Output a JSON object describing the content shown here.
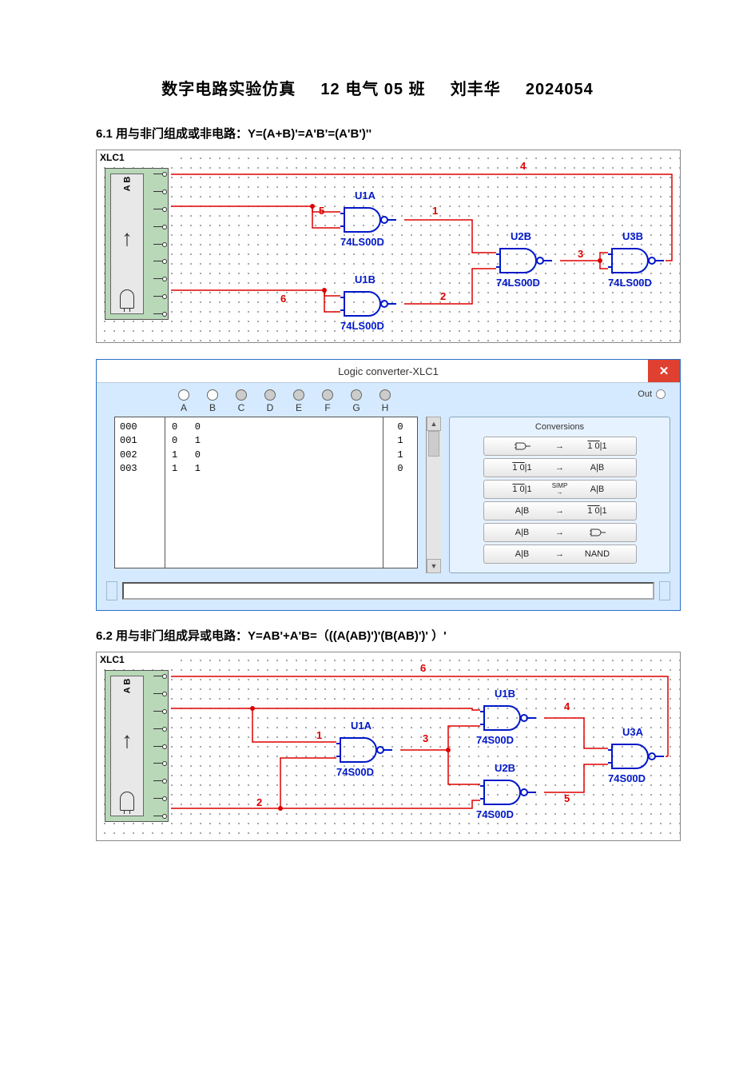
{
  "doc_title": {
    "t1": "数字电路实验仿真",
    "t2": "12 电气 05 班",
    "t3": "刘丰华",
    "t4": "2024054"
  },
  "section1": {
    "heading": "6.1 用与非门组成或非电路：Y=(A+B)'=A'B'=(A'B')''",
    "xlc_label": "XLC1",
    "ab": "A B",
    "gates": {
      "u1a": {
        "ref": "U1A",
        "part": "74LS00D"
      },
      "u1b": {
        "ref": "U1B",
        "part": "74LS00D"
      },
      "u2b": {
        "ref": "U2B",
        "part": "74LS00D"
      },
      "u3b": {
        "ref": "U3B",
        "part": "74LS00D"
      }
    },
    "nets": {
      "n1": "1",
      "n2": "2",
      "n3": "3",
      "n4": "4",
      "n5": "5",
      "n6": "6"
    }
  },
  "logic_converter": {
    "title": "Logic converter-XLC1",
    "out_label": "Out",
    "columns": [
      "A",
      "B",
      "C",
      "D",
      "E",
      "F",
      "G",
      "H"
    ],
    "active_cols": [
      true,
      true,
      false,
      false,
      false,
      false,
      false,
      false
    ],
    "rows": [
      {
        "idx": "000",
        "bits": "0   0",
        "out": "0"
      },
      {
        "idx": "001",
        "bits": "0   1",
        "out": "1"
      },
      {
        "idx": "002",
        "bits": "1   0",
        "out": "1"
      },
      {
        "idx": "003",
        "bits": "1   1",
        "out": "0"
      }
    ],
    "conversions_title": "Conversions",
    "buttons": {
      "b1": {
        "lhs_type": "gate",
        "arrow": "→",
        "rhs_type": "tt"
      },
      "b2": {
        "lhs_type": "tt",
        "arrow": "→",
        "rhs_type": "aib"
      },
      "b3": {
        "lhs_type": "tt",
        "arrow": "SIMP",
        "rhs_type": "aib"
      },
      "b4": {
        "lhs_type": "aib",
        "arrow": "→",
        "rhs_type": "tt"
      },
      "b5": {
        "lhs_type": "aib",
        "arrow": "→",
        "rhs_type": "gate"
      },
      "b6": {
        "lhs_type": "aib",
        "arrow": "→",
        "rhs_type": "nand",
        "rhs_text": "NAND"
      }
    }
  },
  "section2": {
    "heading": "6.2 用与非门组成异或电路：Y=AB'+A'B=（((A(AB)')'(B(AB)')' ）'",
    "xlc_label": "XLC1",
    "ab": "A B",
    "gates": {
      "u1a": {
        "ref": "U1A",
        "part": "74S00D"
      },
      "u1b": {
        "ref": "U1B",
        "part": "74S00D"
      },
      "u2b": {
        "ref": "U2B",
        "part": "74S00D"
      },
      "u3a": {
        "ref": "U3A",
        "part": "74S00D"
      }
    },
    "nets": {
      "n1": "1",
      "n2": "2",
      "n3": "3",
      "n4": "4",
      "n5": "5",
      "n6": "6"
    }
  }
}
